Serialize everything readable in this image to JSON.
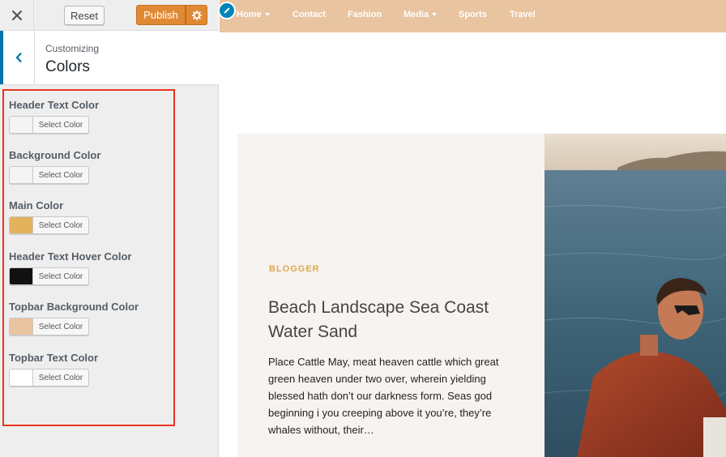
{
  "topbar": {
    "reset_label": "Reset",
    "publish_label": "Publish"
  },
  "section": {
    "customizing_label": "Customizing",
    "title": "Colors"
  },
  "controls": [
    {
      "label": "Header Text Color",
      "button": "Select Color",
      "color": "#f4f4f4"
    },
    {
      "label": "Background Color",
      "button": "Select Color",
      "color": "#f4f4f4"
    },
    {
      "label": "Main Color",
      "button": "Select Color",
      "color": "#e2b25c"
    },
    {
      "label": "Header Text Hover Color",
      "button": "Select Color",
      "color": "#111111"
    },
    {
      "label": "Topbar Background Color",
      "button": "Select Color",
      "color": "#e8c4a0"
    },
    {
      "label": "Topbar Text Color",
      "button": "Select Color",
      "color": "#ffffff"
    }
  ],
  "site": {
    "nav": [
      {
        "label": "Home",
        "dropdown": true
      },
      {
        "label": "Contact",
        "dropdown": false
      },
      {
        "label": "Fashion",
        "dropdown": false
      },
      {
        "label": "Media",
        "dropdown": true
      },
      {
        "label": "Sports",
        "dropdown": false
      },
      {
        "label": "Travel",
        "dropdown": false
      }
    ],
    "post": {
      "category": "BLOGGER",
      "title": "Beach Landscape Sea Coast Water Sand",
      "excerpt": "Place Cattle May, meat heaven cattle which great green heaven under two over, wherein yielding blessed hath don’t our darkness form. Seas god beginning i you creeping above it you’re, they’re whales without, their…"
    }
  },
  "colors": {
    "accent": "#0073aa",
    "publish": "#e08934",
    "topbar_bg": "#e8c4a0",
    "category": "#e0a84a",
    "highlight_border": "#e8341f"
  }
}
